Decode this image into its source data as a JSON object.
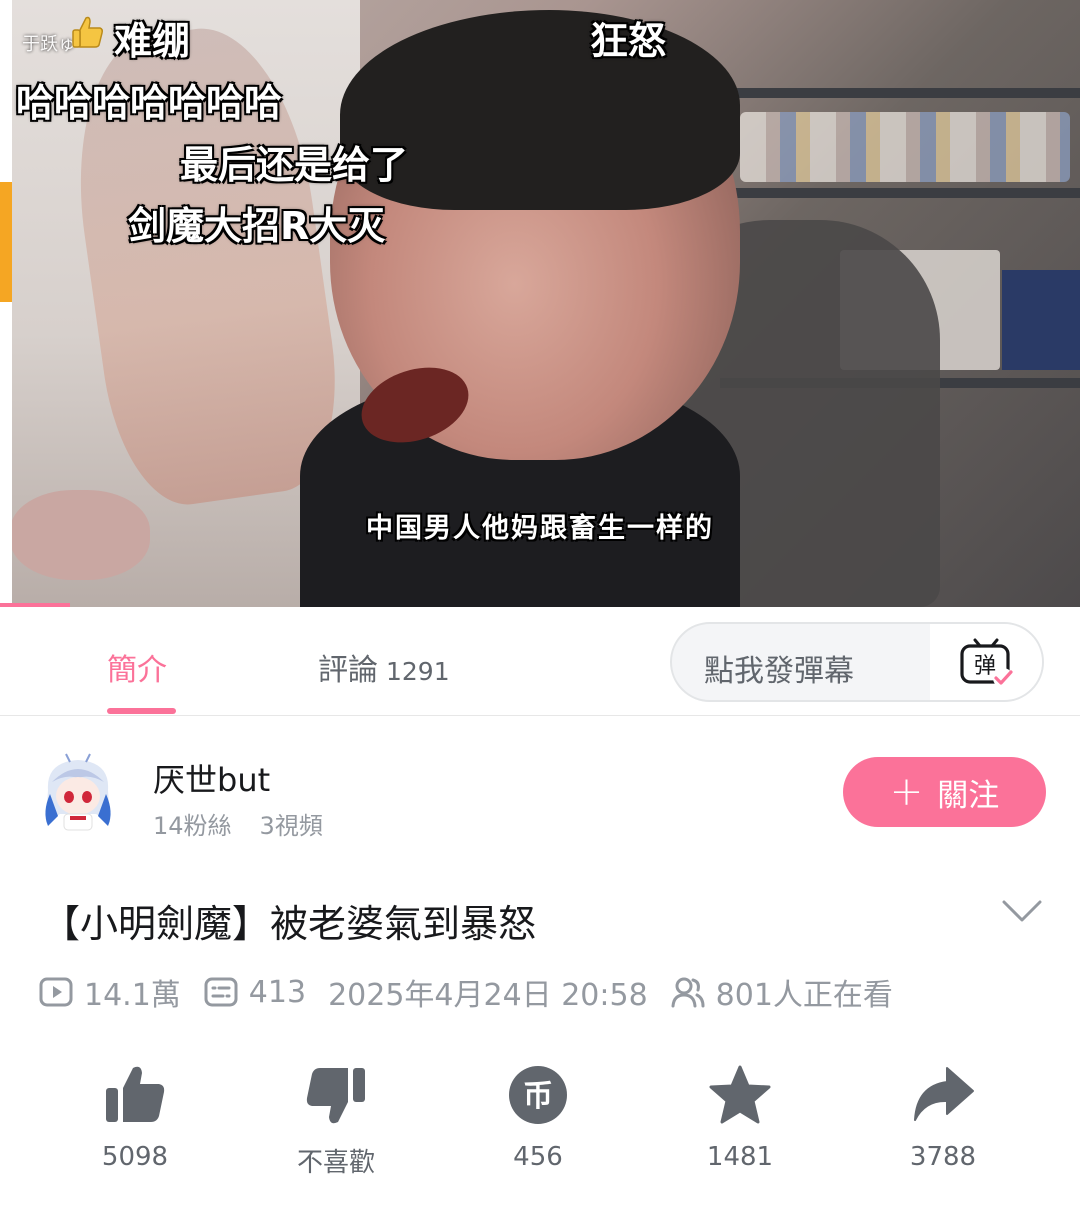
{
  "player": {
    "danmaku": [
      {
        "text": "难绷"
      },
      {
        "text": "狂怒"
      },
      {
        "text": "哈哈哈哈哈哈哈"
      },
      {
        "text": "最后还是给了"
      },
      {
        "text": "剑魔大招R大灭"
      }
    ],
    "danmaku_sender": "于跃ゅ",
    "subtitle": "中国男人他妈跟畜生一样的",
    "progress_fraction": 0.065
  },
  "tabs": {
    "intro": "簡介",
    "comments": "評論",
    "comments_count": "1291",
    "danmaku_placeholder": "點我發彈幕",
    "danmaku_toggle_glyph": "弹"
  },
  "uploader": {
    "name": "厌世but",
    "followers": "14粉絲",
    "videos": "3視頻",
    "follow_label": "關注",
    "follow_plus": "+"
  },
  "video": {
    "title": "【小明劍魔】被老婆氣到暴怒",
    "views": "14.1萬",
    "danmaku_count": "413",
    "datetime": "2025年4月24日 20:58",
    "watching": "801人正在看"
  },
  "actions": {
    "like": "5098",
    "dislike": "不喜歡",
    "coin": "456",
    "favorite": "1481",
    "share": "3788",
    "coin_glyph": "币"
  },
  "colors": {
    "accent": "#fb7299",
    "text_primary": "#18191c",
    "text_secondary": "#61666d",
    "text_muted": "#9499a0",
    "icon_gray": "#61666d"
  },
  "icons": [
    "play-count-icon",
    "danmaku-count-icon",
    "watching-icon",
    "like-icon",
    "dislike-icon",
    "coin-icon",
    "favorite-icon",
    "share-icon",
    "chevron-down-icon",
    "danmaku-toggle-icon"
  ]
}
